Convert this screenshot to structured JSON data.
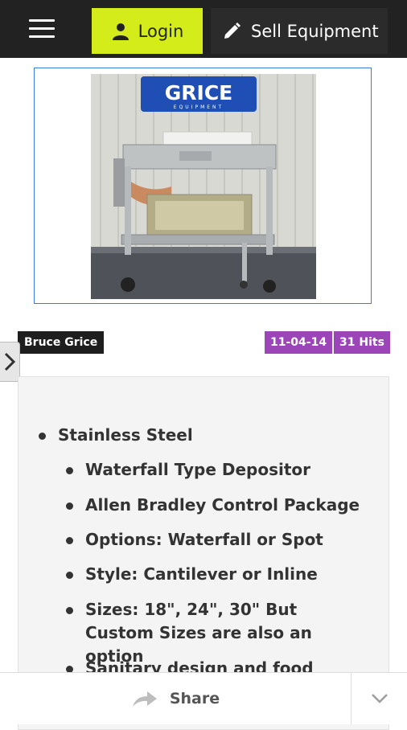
{
  "header": {
    "menu_icon": "hamburger-menu-icon",
    "login_label": "Login",
    "login_icon": "user-icon",
    "sell_label": "Sell Equipment",
    "sell_icon": "pencil-icon",
    "accent_color": "#d4ec1a"
  },
  "listing": {
    "image_logo_text": "GRICE",
    "image_logo_subtext": "EQUIPMENT",
    "author": "Bruce Grice",
    "date": "11-04-14",
    "hits": "31 Hits",
    "badge_color": "#9b45b8",
    "features": [
      "Stainless Steel",
      "Waterfall Type Depositor",
      "Allen Bradley Control Package",
      "Options: Waterfall or Spot",
      "Style: Cantilever or Inline",
      "Sizes: 18\", 24\", 30\" But Custom Sizes are also an option",
      "Sanitary design and food"
    ]
  },
  "footer": {
    "share_label": "Share",
    "share_icon": "share-arrow-icon",
    "expand_icon": "chevron-down-icon"
  },
  "side_tab_icon": "chevron-right-icon"
}
